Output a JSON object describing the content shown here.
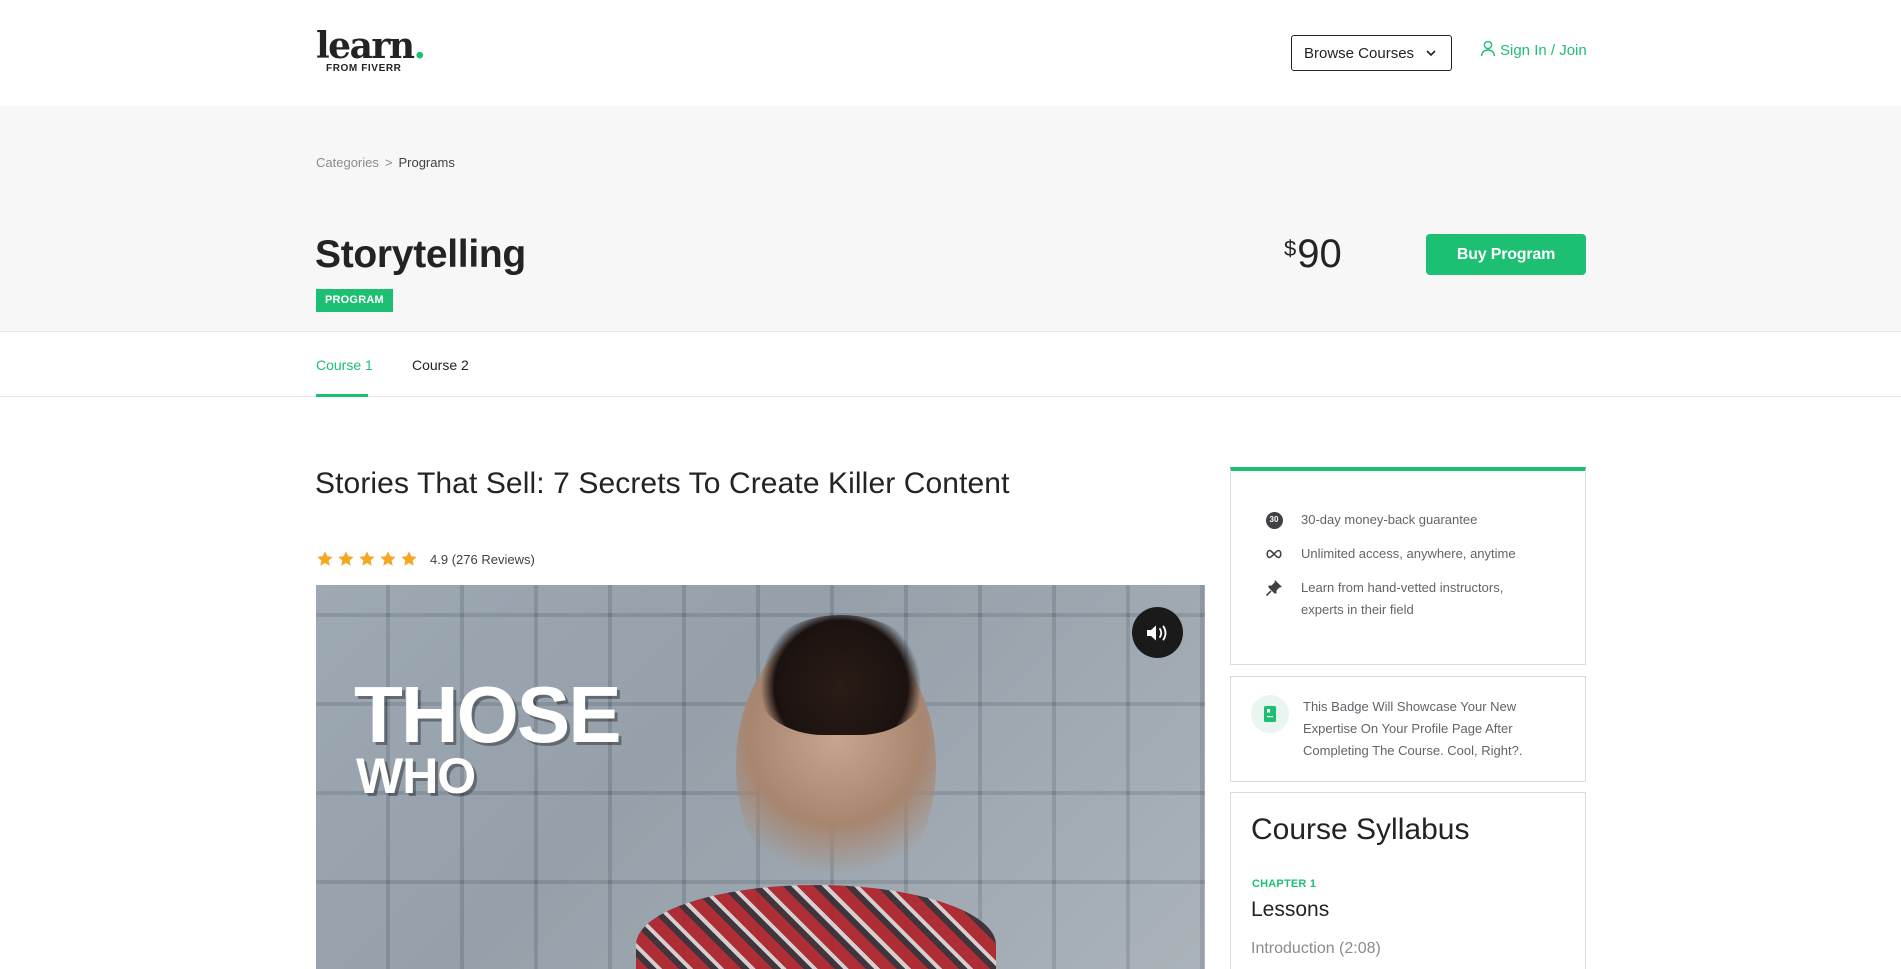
{
  "header": {
    "logo_text": "learn",
    "logo_dot": ".",
    "logo_sub": "FROM FIVERR",
    "browse_label": "Browse Courses",
    "signin_label": "Sign In / Join",
    "accent_color": "#1dbf73"
  },
  "breadcrumb": {
    "items": [
      "Categories",
      "Programs"
    ],
    "separator": ">"
  },
  "program": {
    "title": "Storytelling",
    "badge": "PROGRAM",
    "currency": "$",
    "price": "90",
    "buy_label": "Buy Program"
  },
  "tabs": [
    {
      "label": "Course 1",
      "active": true
    },
    {
      "label": "Course 2",
      "active": false
    }
  ],
  "course": {
    "title": "Stories That Sell: 7 Secrets To Create Killer Content",
    "rating_value": "4.9",
    "reviews_text": "(276 Reviews)",
    "stars": 5,
    "star_color": "#f5a623"
  },
  "video": {
    "overlay_line1": "THOSE",
    "overlay_line2": "WHO",
    "sound_icon": "volume-icon"
  },
  "features": [
    {
      "icon": "thirty-day-icon",
      "icon_text": "30",
      "text": "30-day money-back guarantee"
    },
    {
      "icon": "infinity-icon",
      "text": "Unlimited access, anywhere, anytime"
    },
    {
      "icon": "pin-icon",
      "text_line1": "Learn from hand-vetted instructors,",
      "text_line2": "experts in their field"
    }
  ],
  "badge_card": {
    "icon": "badge-icon",
    "text": "This Badge Will Showcase Your New Expertise On Your Profile Page After Completing The Course. Cool, Right?."
  },
  "syllabus": {
    "title": "Course Syllabus",
    "chapter_label": "CHAPTER 1",
    "chapter_title": "Lessons",
    "lessons": [
      "Introduction (2:08)"
    ]
  }
}
